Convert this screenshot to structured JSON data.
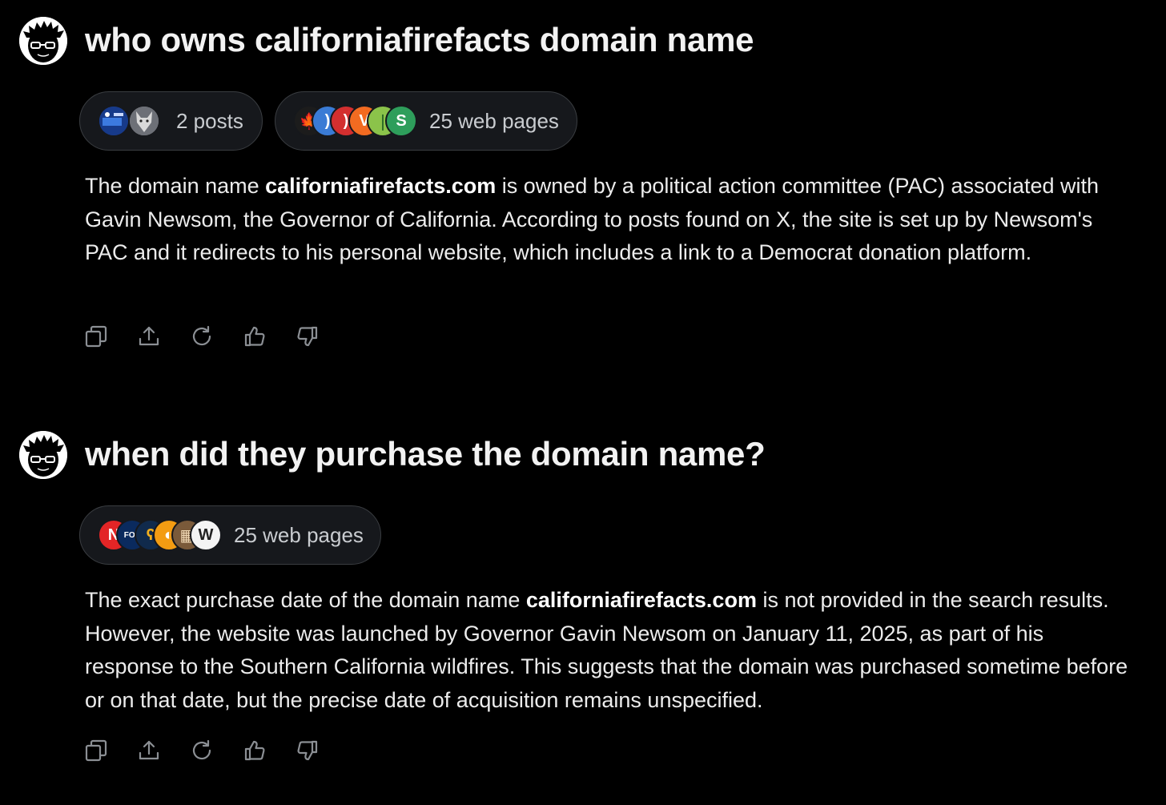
{
  "exchanges": [
    {
      "query": "who owns californiafirefacts domain name",
      "sources": {
        "posts_label": "2 posts",
        "web_label": "25 web pages"
      },
      "answer": {
        "pre": "The domain name ",
        "bold": "californiafirefacts.com",
        "post": " is owned by a political action committee (PAC) associated with Gavin Newsom, the Governor of California. According to posts found on X, the site is set up by Newsom's PAC and it redirects to his personal website, which includes a link to a Democrat donation platform."
      },
      "favicons": [
        {
          "name": "maple-leaf-icon",
          "bg": "#1c1c1c",
          "fg": "#e53935",
          "glyph": "🍁"
        },
        {
          "name": "spiral-logo-icon",
          "bg": "#3a7bd5",
          "fg": "#ffffff",
          "glyph": ")"
        },
        {
          "name": "red-circle-logo-icon",
          "bg": "#d32f2f",
          "fg": "#ffffff",
          "glyph": ")"
        },
        {
          "name": "orange-v-logo-icon",
          "bg": "#f26b21",
          "fg": "#ffffff",
          "glyph": "V"
        },
        {
          "name": "green-leaf-logo-icon",
          "bg": "#8bc34a",
          "fg": "#1b5e20",
          "glyph": "❘"
        },
        {
          "name": "green-s-logo-icon",
          "bg": "#2e9e5b",
          "fg": "#ffffff",
          "glyph": "S"
        }
      ]
    },
    {
      "query": "when did they purchase the domain name?",
      "sources": {
        "web_label": "25 web pages"
      },
      "answer": {
        "pre": "The exact purchase date of the domain name ",
        "bold": "californiafirefacts.com",
        "post": " is not provided in the search results. However, the website was launched by Governor Gavin Newsom on January 11, 2025, as part of his response to the Southern California wildfires. This suggests that the domain was purchased sometime before or on that date, but the precise date of acquisition remains unspecified."
      },
      "favicons": [
        {
          "name": "n-logo-icon",
          "bg": "#e32526",
          "fg": "#ffffff",
          "glyph": "N"
        },
        {
          "name": "fox-news-logo-icon",
          "bg": "#0a2a5e",
          "fg": "#ffffff",
          "glyph": "FOX"
        },
        {
          "name": "bear-logo-icon",
          "bg": "#102a4c",
          "fg": "#f2b01e",
          "glyph": "ʕ"
        },
        {
          "name": "orange-logo-icon",
          "bg": "#f39c12",
          "fg": "#ffffff",
          "glyph": "◐"
        },
        {
          "name": "photo-logo-icon",
          "bg": "#7a5a3a",
          "fg": "#f0d9b5",
          "glyph": "▦"
        },
        {
          "name": "w-logo-icon",
          "bg": "#f4f4f4",
          "fg": "#222222",
          "glyph": "W"
        }
      ]
    }
  ],
  "actions": [
    {
      "name": "copy-icon"
    },
    {
      "name": "share-icon"
    },
    {
      "name": "regenerate-icon"
    },
    {
      "name": "thumbs-up-icon"
    },
    {
      "name": "thumbs-down-icon"
    }
  ],
  "colors": {
    "background": "#000000",
    "pill_border": "#3a3d41",
    "pill_bg": "#16181c",
    "text": "#ececec",
    "icon": "#8b8f94"
  }
}
